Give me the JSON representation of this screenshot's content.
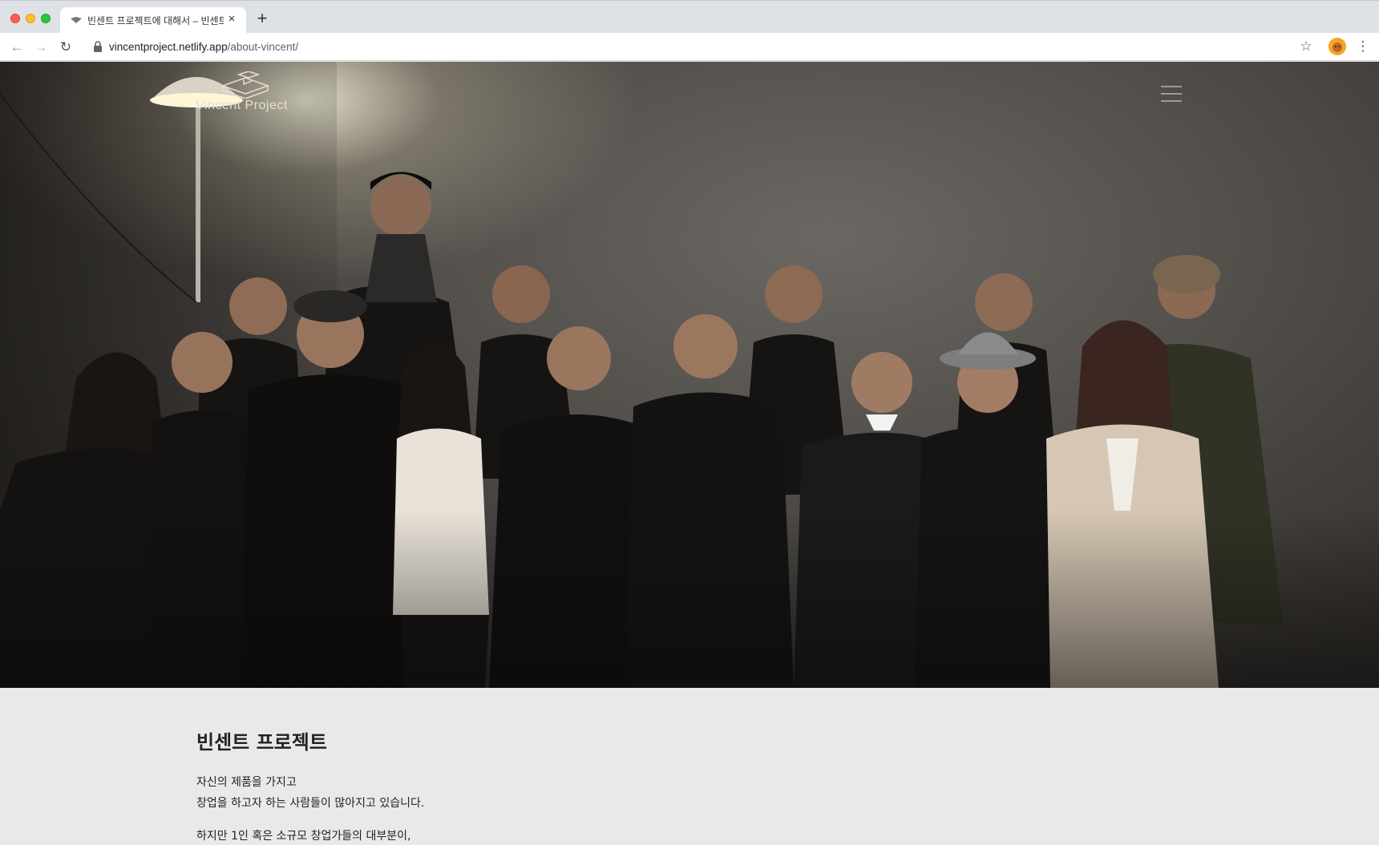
{
  "browser": {
    "tab_title": "빈센트 프로젝트에 대해서 – 빈센트 프",
    "tab_close_glyph": "×",
    "new_tab_glyph": "+",
    "back_glyph": "←",
    "forward_glyph": "→",
    "reload_glyph": "↻",
    "url_host": "vincentproject.netlify.app",
    "url_path": "/about-vincent/",
    "star_glyph": "☆",
    "menu_glyph": "⋮",
    "icons": [
      "back-arrow-icon",
      "forward-arrow-icon",
      "reload-icon",
      "lock-icon",
      "bookmark-star-icon",
      "profile-avatar",
      "kebab-menu-icon"
    ]
  },
  "site": {
    "logo_text": "Vincent Project",
    "menu_icon": "hamburger-icon",
    "hero_photo": "group photo of the team standing in front of a concrete wall with a floor lamp"
  },
  "content": {
    "title": "빈센트 프로젝트",
    "paragraphs": [
      "자신의 제품을 가지고",
      "창업을 하고자 하는 사람들이 많아지고 있습니다.",
      "하지만 1인 혹은 소규모 창업가들의 대부분이,"
    ]
  },
  "colors": {
    "page_background": "#e9e9e9",
    "text": "#222222",
    "logo": "#e8e0d0"
  }
}
